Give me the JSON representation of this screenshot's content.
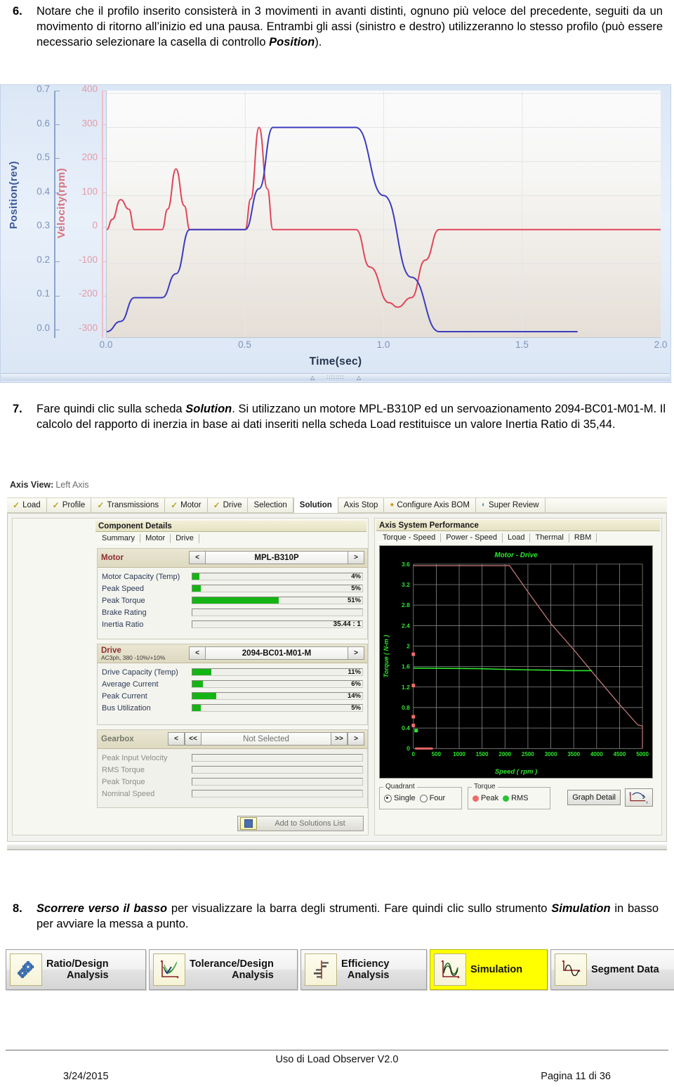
{
  "steps": [
    {
      "number": "6.",
      "segments": [
        {
          "t": "Notare che il profilo inserito consisterà in 3 movimenti in avanti distinti, ognuno più veloce del precedente, seguiti da un movimento di ritorno all’inizio ed una pausa. Entrambi gli assi (sinistro e destro) utilizzeranno lo stesso profilo (può essere necessario selezionare la casella di controllo ",
          "s": "n"
        },
        {
          "t": "Position",
          "s": "bi"
        },
        {
          "t": ").",
          "s": "n"
        }
      ]
    },
    {
      "number": "7.",
      "segments": [
        {
          "t": "Fare quindi clic sulla scheda ",
          "s": "n"
        },
        {
          "t": "Solution",
          "s": "bi"
        },
        {
          "t": ". Si utilizzano un motore MPL-B310P ed un servoazionamento 2094-BC01-M01-M. Il calcolo del rapporto di inerzia in base ai dati inseriti nella scheda Load restituisce un valore Inertia Ratio di 35,44.",
          "s": "n"
        }
      ]
    },
    {
      "number": "8.",
      "segments": [
        {
          "t": "Scorrere verso il basso",
          "s": "bi"
        },
        {
          "t": " per visualizzare la barra degli strumenti. Fare quindi clic sullo strumento ",
          "s": "n"
        },
        {
          "t": "Simulation",
          "s": "bi"
        },
        {
          "t": " in basso per avviare la messa a punto.",
          "s": "n"
        }
      ]
    }
  ],
  "chart_data": {
    "type": "line",
    "title": "",
    "xlabel": "Time(sec)",
    "x": [
      0.0,
      0.5,
      1.0,
      1.5,
      2.0
    ],
    "xlim": [
      0.0,
      2.0
    ],
    "xticks": [
      "0.0",
      "0.5",
      "1.0",
      "1.5",
      "2.0"
    ],
    "axes": [
      {
        "name": "Position(rev)",
        "label": "Position(rev)",
        "color": "#3b3bbf",
        "ticks": [
          "0.7",
          "0.6",
          "0.5",
          "0.4",
          "0.3",
          "0.2",
          "0.1",
          "0.0"
        ],
        "lim": [
          0.0,
          0.7
        ]
      },
      {
        "name": "Velocity(rpm)",
        "label": "Velocity(rpm)",
        "color": "#e0465a",
        "ticks": [
          "400",
          "300",
          "200",
          "100",
          "0",
          "-100",
          "-200",
          "-300"
        ],
        "lim": [
          -300,
          400
        ]
      }
    ],
    "series": [
      {
        "name": "Velocity(rpm)",
        "axis": "Velocity(rpm)",
        "color": "#e0465a",
        "points": [
          [
            0.0,
            0
          ],
          [
            0.02,
            30
          ],
          [
            0.05,
            88
          ],
          [
            0.08,
            60
          ],
          [
            0.1,
            0
          ],
          [
            0.2,
            0
          ],
          [
            0.22,
            60
          ],
          [
            0.25,
            178
          ],
          [
            0.28,
            70
          ],
          [
            0.3,
            0
          ],
          [
            0.5,
            0
          ],
          [
            0.52,
            90
          ],
          [
            0.55,
            300
          ],
          [
            0.58,
            120
          ],
          [
            0.6,
            0
          ],
          [
            0.9,
            0
          ],
          [
            0.95,
            -110
          ],
          [
            1.02,
            -215
          ],
          [
            1.05,
            -228
          ],
          [
            1.1,
            -200
          ],
          [
            1.15,
            -90
          ],
          [
            1.2,
            0
          ],
          [
            2.0,
            0
          ]
        ]
      },
      {
        "name": "Position(rev)",
        "axis": "Position(rev)",
        "color": "#3b3bbf",
        "points": [
          [
            0.0,
            0.0
          ],
          [
            0.05,
            0.03
          ],
          [
            0.1,
            0.1
          ],
          [
            0.2,
            0.1
          ],
          [
            0.25,
            0.17
          ],
          [
            0.3,
            0.3
          ],
          [
            0.5,
            0.3
          ],
          [
            0.55,
            0.42
          ],
          [
            0.6,
            0.6
          ],
          [
            0.9,
            0.6
          ],
          [
            1.0,
            0.4
          ],
          [
            1.1,
            0.16
          ],
          [
            1.2,
            0.0
          ],
          [
            1.7,
            0.0
          ]
        ]
      }
    ]
  },
  "app": {
    "axis_view": {
      "label": "Axis View:",
      "value": "Left Axis"
    },
    "tabs": [
      {
        "label": "Load",
        "check": true,
        "active": false
      },
      {
        "label": "Profile",
        "check": true,
        "active": false
      },
      {
        "label": "Transmissions",
        "check": true,
        "active": false
      },
      {
        "label": "Motor",
        "check": true,
        "active": false
      },
      {
        "label": "Drive",
        "check": true,
        "active": false
      },
      {
        "label": "Selection",
        "check": false,
        "active": false
      },
      {
        "label": "Solution",
        "check": false,
        "active": true
      },
      {
        "label": "Axis Stop",
        "check": false,
        "active": false
      },
      {
        "label": "Configure Axis BOM",
        "check": false,
        "active": false,
        "icon": "warning-icon"
      },
      {
        "label": "Super Review",
        "check": false,
        "active": false,
        "icon": "gauge-icon"
      }
    ],
    "component_details": {
      "header": "Component Details",
      "subtabs": [
        "Summary",
        "Motor",
        "Drive"
      ],
      "active_subtab": "Summary",
      "motor": {
        "title": "Motor",
        "selected": "MPL-B310P",
        "prev": "<",
        "next": ">",
        "rows": [
          {
            "label": "Motor Capacity (Temp)",
            "value": "4%",
            "pct": 4
          },
          {
            "label": "Peak Speed",
            "value": "5%",
            "pct": 5
          },
          {
            "label": "Peak Torque",
            "value": "51%",
            "pct": 51
          },
          {
            "label": "Brake Rating",
            "value": "",
            "pct": 0
          },
          {
            "label": "Inertia Ratio",
            "value": "35.44 : 1",
            "pct": 0
          }
        ]
      },
      "drive": {
        "title": "Drive",
        "subtitle": "AC3ph, 380 -10%/+10%",
        "selected": "2094-BC01-M01-M",
        "prev": "<",
        "next": ">",
        "rows": [
          {
            "label": "Drive Capacity (Temp)",
            "value": "11%",
            "pct": 11
          },
          {
            "label": "Average Current",
            "value": "6%",
            "pct": 6
          },
          {
            "label": "Peak Current",
            "value": "14%",
            "pct": 14
          },
          {
            "label": "Bus Utilization",
            "value": "5%",
            "pct": 5
          }
        ]
      },
      "gearbox": {
        "title": "Gearbox",
        "selected": "Not Selected",
        "first": "<<",
        "prev": "<",
        "next": ">",
        "last": ">>",
        "rows": [
          {
            "label": "Peak Input Velocity",
            "value": ""
          },
          {
            "label": "RMS Torque",
            "value": ""
          },
          {
            "label": "Peak Torque",
            "value": ""
          },
          {
            "label": "Nominal Speed",
            "value": ""
          }
        ]
      },
      "add_to_solutions": "Add to Solutions List"
    },
    "axis_system_performance": {
      "header": "Axis System Performance",
      "tabs": [
        "Torque - Speed",
        "Power - Speed",
        "Load",
        "Thermal",
        "RBM"
      ],
      "active_tab": "Torque - Speed",
      "controls": {
        "quadrant_legend": "Quadrant",
        "quadrant_options": [
          "Single",
          "Four"
        ],
        "quadrant_selected": "Single",
        "torque_legend": "Torque",
        "torque_options": [
          "Peak",
          "RMS"
        ],
        "graph_detail": "Graph Detail"
      },
      "chart_data": {
        "type": "line",
        "title": "Motor - Drive",
        "xlabel": "Speed ( rpm )",
        "ylabel": "Torque ( N-m )",
        "xlim": [
          0,
          5000
        ],
        "ylim": [
          0,
          3.6
        ],
        "xticks": [
          "0",
          "500",
          "1000",
          "1500",
          "2000",
          "2500",
          "3000",
          "3500",
          "4000",
          "4500",
          "5000"
        ],
        "yticks": [
          "0",
          "0.4",
          "0.8",
          "1.2",
          "1.6",
          "2",
          "2.4",
          "2.8",
          "3.2",
          "3.6"
        ],
        "background": "#000000",
        "grid": true,
        "series": [
          {
            "name": "Peak Torque",
            "color": "#c97f7f",
            "points": [
              [
                0,
                3.57
              ],
              [
                2100,
                3.57
              ],
              [
                2500,
                3.06
              ],
              [
                3000,
                2.44
              ],
              [
                3500,
                1.93
              ],
              [
                4000,
                1.39
              ],
              [
                4500,
                0.86
              ],
              [
                4900,
                0.46
              ],
              [
                5000,
                0.44
              ],
              [
                5000,
                0.0
              ]
            ]
          },
          {
            "name": "RMS Torque",
            "color": "#2ee62e",
            "points": [
              [
                0,
                1.57
              ],
              [
                1400,
                1.56
              ],
              [
                2200,
                1.54
              ],
              [
                2900,
                1.53
              ],
              [
                3350,
                1.52
              ],
              [
                3900,
                1.52
              ]
            ]
          }
        ],
        "markers": [
          {
            "label": "peak",
            "color": "#f06a6a",
            "x": 0,
            "y": 1.84
          },
          {
            "label": "peak",
            "color": "#f06a6a",
            "x": 0,
            "y": 1.23
          },
          {
            "label": "peak",
            "color": "#f06a6a",
            "x": 0,
            "y": 0.62
          },
          {
            "label": "peak",
            "color": "#f06a6a",
            "x": 0,
            "y": 0.45
          },
          {
            "label": "rms",
            "color": "#2ee62e",
            "x": 60,
            "y": 0.35
          }
        ]
      }
    }
  },
  "toolbar": {
    "tools": [
      {
        "label": "Ratio/Design\nAnalysis",
        "icon": "gears-icon",
        "highlight": false
      },
      {
        "label": "Tolerance/Design\nAnalysis",
        "icon": "curve-chart-icon",
        "highlight": false
      },
      {
        "label": "Efficiency\nAnalysis",
        "icon": "bar-chart-icon",
        "highlight": false
      },
      {
        "label": "Simulation",
        "icon": "waveform-icon",
        "highlight": true
      },
      {
        "label": "Segment Data",
        "icon": "segment-icon",
        "highlight": false
      }
    ]
  },
  "footer": {
    "center": "Uso di Load Observer V2.0",
    "date": "3/24/2015",
    "page": "Pagina 11 di 36"
  }
}
